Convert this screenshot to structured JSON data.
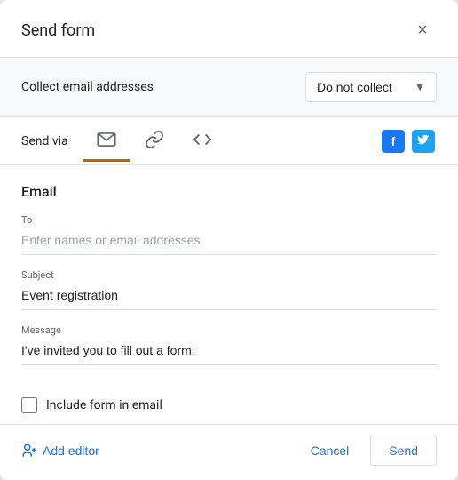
{
  "dialog": {
    "title": "Send form",
    "close_label": "×"
  },
  "collect_row": {
    "label": "Collect email addresses",
    "dropdown_value": "Do not collect",
    "dropdown_chevron": "▼"
  },
  "send_via": {
    "label": "Send via",
    "tabs": [
      {
        "id": "email",
        "icon": "✉",
        "active": true,
        "aria": "Email tab"
      },
      {
        "id": "link",
        "icon": "🔗",
        "active": false,
        "aria": "Link tab"
      },
      {
        "id": "embed",
        "icon": "<>",
        "active": false,
        "aria": "Embed tab"
      }
    ],
    "social": [
      {
        "id": "facebook",
        "label": "f",
        "aria": "Share on Facebook"
      },
      {
        "id": "twitter",
        "label": "t",
        "aria": "Share on Twitter"
      }
    ]
  },
  "email_section": {
    "title": "Email",
    "to_label": "To",
    "to_placeholder": "Enter names or email addresses",
    "to_value": "",
    "subject_label": "Subject",
    "subject_value": "Event registration",
    "message_label": "Message",
    "message_value": "I've invited you to fill out a form:"
  },
  "checkbox": {
    "label": "Include form in email",
    "checked": false
  },
  "footer": {
    "add_editor_label": "Add editor",
    "cancel_label": "Cancel",
    "send_label": "Send"
  }
}
